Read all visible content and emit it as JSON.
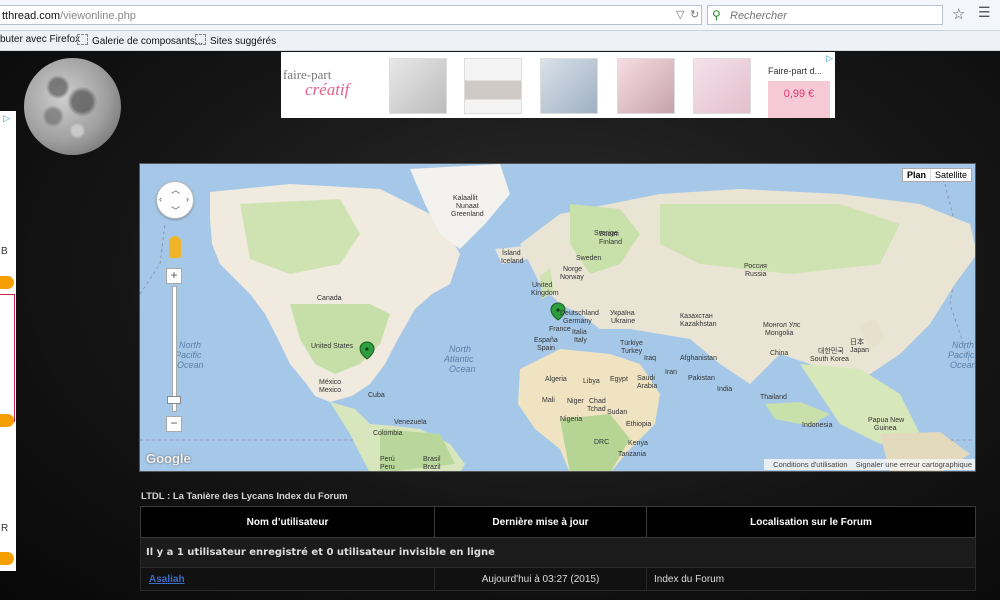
{
  "browser": {
    "url_host": "tthread.com",
    "url_path": "/viewonline.php",
    "search_placeholder": "Rechercher",
    "bookmarks": [
      "buter avec Firefox",
      "Galerie de composants...",
      "Sites suggérés"
    ]
  },
  "top_ad": {
    "logo_line1": "faire-part",
    "logo_line2": "créatif",
    "last_title": "Faire-part d...",
    "last_price": "0,99 €"
  },
  "left_ad": {
    "texts": [
      "B",
      "R"
    ]
  },
  "map": {
    "type_buttons": [
      "Plan",
      "Satellite"
    ],
    "google_logo": "Google",
    "footer": [
      "Conditions d'utilisation",
      "Signaler une erreur cartographique"
    ],
    "zoom_in": "+",
    "zoom_out": "−",
    "labels": {
      "kalaallit": "Kalaallit",
      "nunaat": "Nunaat",
      "greenland": "Greenland",
      "sverige": "Sverige",
      "suomi": "Suomi",
      "finland": "Finland",
      "island": "Ísland",
      "iceland": "Iceland",
      "norge": "Norge",
      "norway": "Norway",
      "sweden": "Sweden",
      "russia_ru": "Россия",
      "russia": "Russia",
      "uk1": "United",
      "uk2": "Kingdom",
      "deutschland": "Deutschland",
      "germany": "Germany",
      "ukraine_ua": "Україна",
      "ukraine": "Ukraine",
      "kazakhstan_ru": "Казахстан",
      "kazakhstan": "Kazakhstan",
      "mongolia_mn": "Монгол Улс",
      "mongolia": "Mongolia",
      "france": "France",
      "espana": "España",
      "spain": "Spain",
      "italia": "Italia",
      "italy": "Italy",
      "turkiye": "Türkiye",
      "turkey": "Turkey",
      "canada": "Canada",
      "united_states": "United States",
      "mexico1": "México",
      "mexico2": "Mexico",
      "cuba": "Cuba",
      "venezuela": "Venezuela",
      "colombia": "Colombia",
      "peru1": "Perú",
      "peru2": "Peru",
      "brasil": "Brasil",
      "brazil": "Brazil",
      "algeria": "Algeria",
      "libya": "Libya",
      "egypt": "Egypt",
      "mali": "Mali",
      "niger": "Niger",
      "chad": "Chad",
      "tchad": "Tchad",
      "sudan": "Sudan",
      "ethiopia": "Ethiopia",
      "nigeria": "Nigeria",
      "drc": "DRC",
      "kenya": "Kenya",
      "tanzania": "Tanzania",
      "iraq": "Iraq",
      "iran": "Iran",
      "saudi1": "Saudi",
      "saudi2": "Arabia",
      "afghanistan": "Afghanistan",
      "pakistan": "Pakistan",
      "india": "India",
      "china": "China",
      "japan_jp": "日本",
      "japan": "Japan",
      "korea_kr": "대한민국",
      "south_korea": "South Korea",
      "thailand": "Thailand",
      "indonesia": "Indonesia",
      "png1": "Papua New",
      "png2": "Guinea",
      "pacific1": "North",
      "pacific2": "Pacific",
      "pacific3": "Ocean",
      "atlantic1": "North",
      "atlantic2": "Atlantic",
      "atlantic3": "Ocean",
      "pacific_r1": "North",
      "pacific_r2": "Pacific",
      "pacific_r3": "Ocean"
    }
  },
  "forum": {
    "breadcrumb": "LTDL : La Tanière des Lycans Index du Forum",
    "headers": [
      "Nom d’utilisateur",
      "Dernière mise à jour",
      "Localisation sur le Forum"
    ],
    "summary": "Il y a 1 utilisateur enregistré et 0 utilisateur invisible en ligne",
    "row": {
      "user": "Asaliah",
      "time": "Aujourd'hui à 03:27 (2015)",
      "location": "Index du Forum"
    }
  }
}
